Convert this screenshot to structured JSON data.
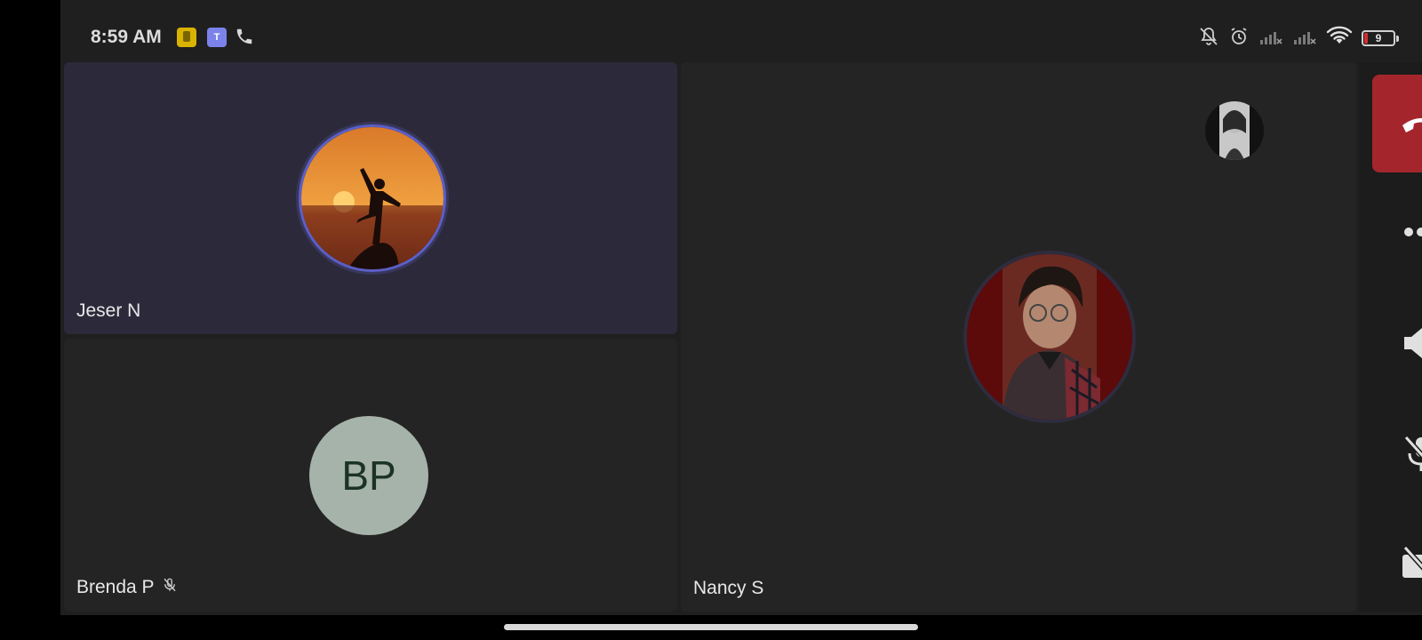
{
  "status_bar": {
    "time": "8:59 AM",
    "app_icons": [
      "notes-app-icon",
      "teams-app-icon",
      "phone-icon"
    ],
    "teams_glyph": "T",
    "right_icons": [
      "bell-off-icon",
      "alarm-icon",
      "signal-x-icon",
      "signal-x-icon",
      "wifi-icon"
    ],
    "battery_level": "9",
    "battery_color": "#d32f2f"
  },
  "participants": [
    {
      "name": "Jeser N",
      "avatar": "sunset-photo",
      "speaking": true
    },
    {
      "name": "Brenda P",
      "initials": "BP",
      "muted": true
    },
    {
      "name": "Nancy S",
      "avatar": "profile-photo"
    }
  ],
  "controls": {
    "hangup": "hangup-icon",
    "more": "more-icon",
    "speaker": "speaker-icon",
    "mic": "mic-off-icon",
    "camera": "camera-off-icon"
  },
  "colors": {
    "hangup": "#a4262c",
    "speaking_ring": "#5b5fc7",
    "initials_avatar_bg": "#a6b3aa"
  }
}
